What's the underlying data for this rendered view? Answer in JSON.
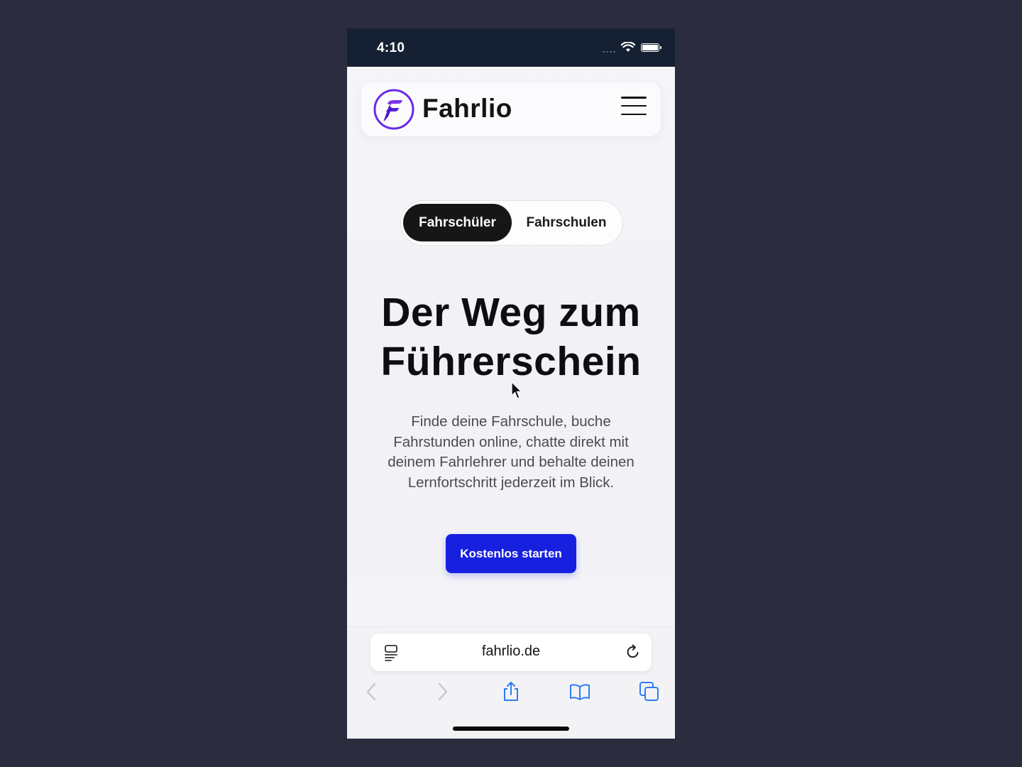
{
  "status_bar": {
    "time": "4:10"
  },
  "header": {
    "logo_text": "Fahrlio"
  },
  "segment": {
    "options": [
      "Fahrschüler",
      "Fahrschulen"
    ],
    "selected": "Fahrschüler"
  },
  "hero": {
    "title_line1": "Der Weg zum",
    "title_line2": "Führerschein",
    "text": "Finde deine Fahrschule, buche Fahrstunden online, chatte direkt mit deinem Fahrlehrer und behalte deinen Lernfortschritt jederzeit im Blick.",
    "cta_label": "Kostenlos starten"
  },
  "browser": {
    "url": "fahrlio.de",
    "toolbar": [
      "back-icon",
      "forward-icon",
      "share-icon",
      "bookmarks-icon",
      "tabs-icon"
    ]
  },
  "colors": {
    "background": "#2b2d3f",
    "status_bar": "#162033",
    "cta": "#1820e0",
    "logo_purple": "#6a2ae8",
    "logo_violet": "#8b3cf0",
    "ios_blue": "#2f7cf6"
  }
}
